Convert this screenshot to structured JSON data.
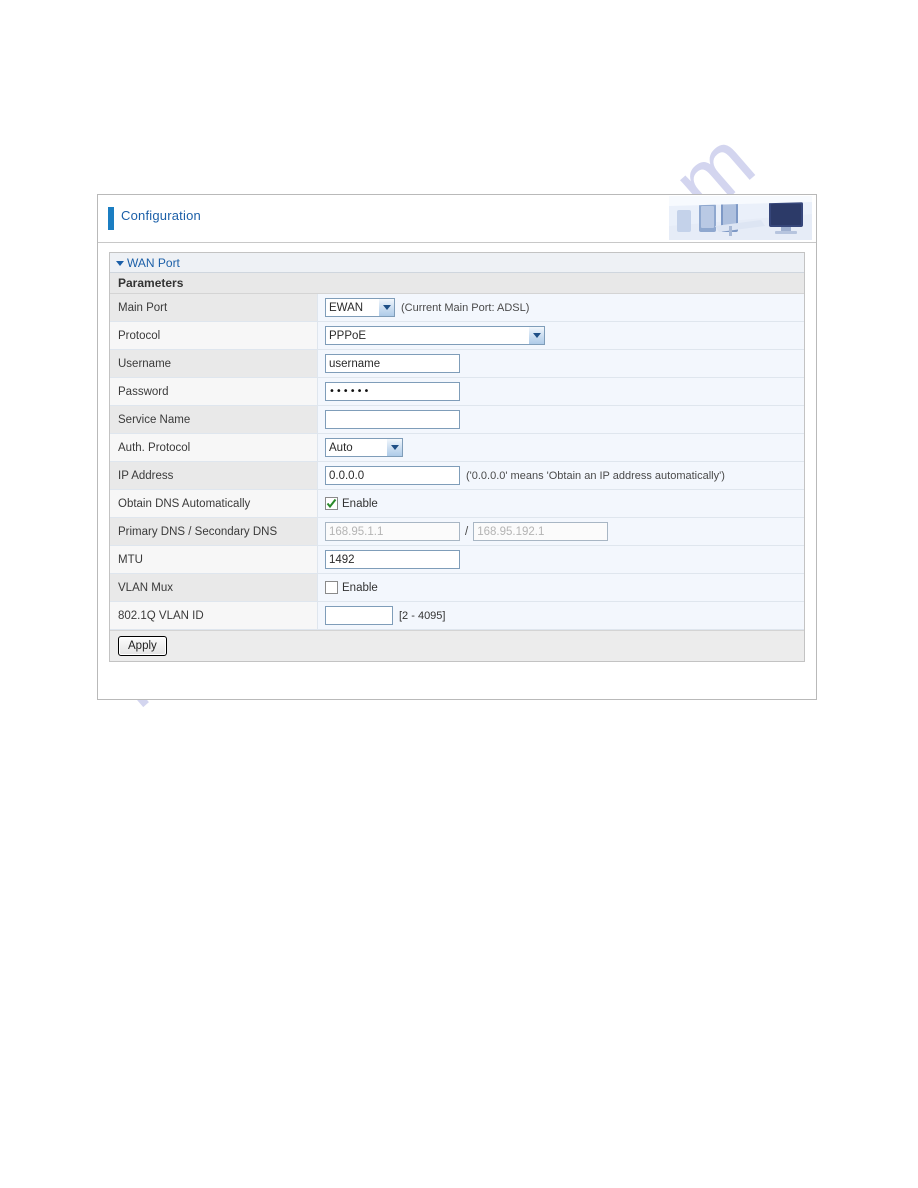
{
  "banner": {
    "title": "Configuration",
    "art_icon": "office-computers-image"
  },
  "panel": {
    "section_title": "WAN Port",
    "subheading": "Parameters",
    "rows": [
      {
        "label": "Main Port",
        "control": "select",
        "value": "EWAN",
        "hint": "(Current Main Port: ADSL)"
      },
      {
        "label": "Protocol",
        "control": "select",
        "value": "PPPoE",
        "hint": ""
      },
      {
        "label": "Username",
        "control": "text",
        "value": "username",
        "hint": ""
      },
      {
        "label": "Password",
        "control": "password",
        "value": "••••••",
        "hint": ""
      },
      {
        "label": "Service Name",
        "control": "text",
        "value": "",
        "hint": ""
      },
      {
        "label": "Auth. Protocol",
        "control": "select",
        "value": "Auto",
        "hint": ""
      },
      {
        "label": "IP Address",
        "control": "text",
        "value": "0.0.0.0",
        "hint": "('0.0.0.0' means 'Obtain an IP address automatically')"
      },
      {
        "label": "Obtain DNS Automatically",
        "control": "checkbox",
        "checked": true,
        "checkbox_label": "Enable",
        "hint": ""
      },
      {
        "label": "Primary DNS / Secondary DNS",
        "control": "dual-text-disabled",
        "primary_value": "168.95.1.1",
        "separator": "/",
        "secondary_value": "168.95.192.1",
        "hint": ""
      },
      {
        "label": "MTU",
        "control": "text",
        "value": "1492",
        "hint": ""
      },
      {
        "label": "VLAN Mux",
        "control": "checkbox",
        "checked": false,
        "checkbox_label": "Enable",
        "hint": ""
      },
      {
        "label": "802.1Q VLAN ID",
        "control": "text-small",
        "value": "",
        "hint": "[2 - 4095]"
      }
    ],
    "apply_label": "Apply"
  },
  "watermark": {
    "text": "manualsarchive.com"
  },
  "colors": {
    "accent_blue": "#1b7ec2",
    "title_blue": "#1b5fa8",
    "row_alt": "#e9e9e9",
    "row_norm": "#f7f7f7",
    "field_bg": "#f3f7fd",
    "check_green": "#2a8a2a"
  }
}
